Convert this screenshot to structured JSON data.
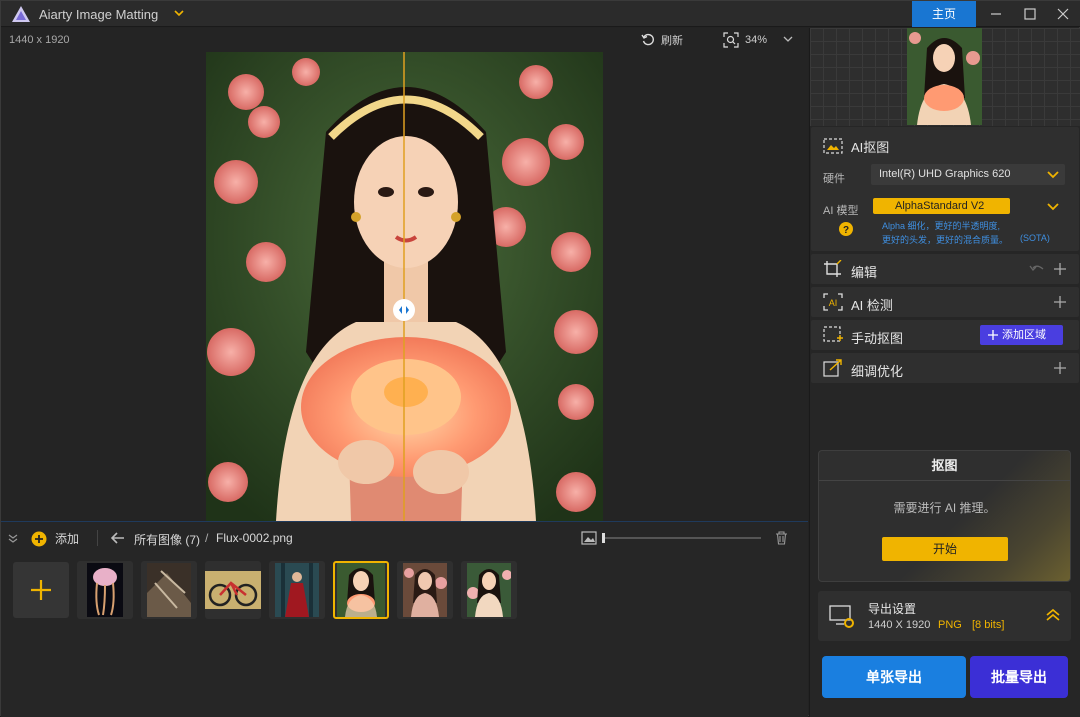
{
  "titlebar": {
    "app_title": "Aiarty Image Matting",
    "home_label": "主页"
  },
  "stage": {
    "dims": "1440 x 1920",
    "refresh_label": "刷新",
    "zoom_value": "34%"
  },
  "filebar": {
    "add_label": "添加",
    "all_images": "所有图像 (7)",
    "separator": "/",
    "filename": "Flux-0002.png"
  },
  "thumbs": [
    {
      "name": "jellyfish"
    },
    {
      "name": "rocks"
    },
    {
      "name": "bicycle"
    },
    {
      "name": "red-dress"
    },
    {
      "name": "girl-flower",
      "selected": true
    },
    {
      "name": "girl-roses"
    },
    {
      "name": "girl-garden"
    }
  ],
  "panel": {
    "ai_matting": {
      "title": "AI抠图",
      "hardware_label": "硬件",
      "hardware_value": "Intel(R) UHD Graphics 620",
      "model_label": "AI 模型",
      "model_value": "AlphaStandard  V2",
      "model_desc_1": "Alpha 细化，更好的半透明度,",
      "model_desc_2": "更好的头发，更好的混合质量。",
      "model_desc_tag": "(SOTA)"
    },
    "edit": {
      "title": "编辑"
    },
    "ai_detect": {
      "title": "AI 检测"
    },
    "manual": {
      "title": "手动抠图",
      "add_region_label": "添加区域"
    },
    "refine": {
      "title": "细调优化"
    },
    "matting_card": {
      "title": "抠图",
      "message": "需要进行 AI 推理。",
      "start_label": "开始"
    },
    "export_settings": {
      "title": "导出设置",
      "size": "1440 X 1920",
      "format": "PNG",
      "bits": "[8 bits]"
    },
    "export_single_label": "单张导出",
    "export_batch_label": "批量导出"
  },
  "colors": {
    "accent_yellow": "#f0b400",
    "accent_blue": "#1976d2",
    "accent_purple": "#3b2fd6"
  }
}
